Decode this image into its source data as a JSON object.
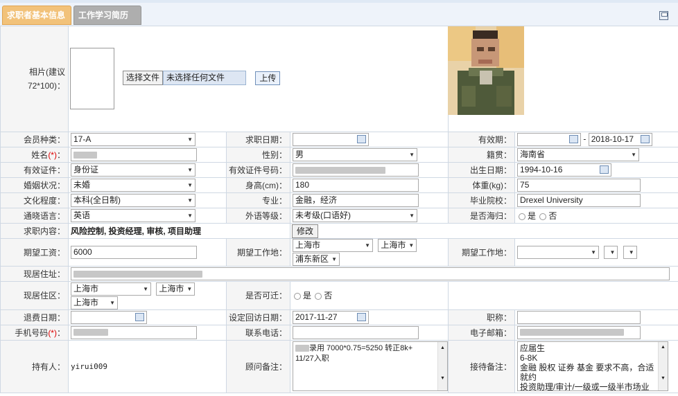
{
  "tabs": {
    "basic": "求职者基本信息",
    "resume": "工作学习简历"
  },
  "photo_label": "相片(建议72*100)：",
  "file": {
    "choose": "选择文件",
    "none": "未选择任何文件",
    "upload": "上传"
  },
  "f": {
    "member_type_l": "会员种类：",
    "member_type": "17-A",
    "apply_date_l": "求职日期：",
    "apply_date": "",
    "valid_l": "有效期：",
    "valid_from": "",
    "valid_dash": "-",
    "valid_to": "2018-10-17",
    "name_l": "姓名",
    "name_req": "(*)",
    "name_colon": "：",
    "gender_l": "性别：",
    "gender": "男",
    "native_l": "籍贯：",
    "native": "海南省",
    "idtype_l": "有效证件：",
    "idtype": "身份证",
    "idno_l": "有效证件号码：",
    "birth_l": "出生日期：",
    "birth": "1994-10-16",
    "marital_l": "婚姻状况：",
    "marital": "未婚",
    "height_l": "身高(cm)：",
    "height": "180",
    "weight_l": "体重(kg)：",
    "weight": "75",
    "edu_l": "文化程度：",
    "edu": "本科(全日制)",
    "major_l": "专业：",
    "major": "金融，经济",
    "school_l": "毕业院校：",
    "school": "Drexel University",
    "lang_l": "通晓语言：",
    "lang": "英语",
    "foreign_l": "外语等级：",
    "foreign": "未考级(口语好)",
    "overseas_l": "是否海归：",
    "yes": "是",
    "no": "否",
    "content_l": "求职内容：",
    "content": "风险控制, 投资经理, 审核, 项目助理",
    "modify": "修改",
    "salary_l": "期望工资：",
    "salary": "6000",
    "work_place_l": "期望工作地：",
    "wp1": "上海市",
    "wp2": "上海市",
    "wp3": "浦东新区",
    "work_place2_l": "期望工作地：",
    "address_l": "现居住址：",
    "live_area_l": "现居住区：",
    "la1": "上海市",
    "la2": "上海市",
    "la3": "上海市",
    "move_l": "是否可迁：",
    "refund_l": "退费日期：",
    "callback_l": "设定回访日期：",
    "callback": "2017-11-27",
    "title_l": "职称：",
    "mobile_l": "手机号码",
    "mobile_req": "(*)",
    "phone_l": "联系电话：",
    "email_l": "电子邮箱：",
    "holder_l": "持有人：",
    "holder": "yirui009",
    "consult_l": "顾问备注：",
    "consult1": "录用 7000*0.75=5250  转正8k+",
    "consult2": "11/27入职",
    "reception_l": "接待备注：",
    "rec1": "应届生",
    "rec2": "6-8K",
    "rec3": "金融 股权 证券 基金 要求不高，合适就约",
    "rec4": "投资助理/审计/一级或一级半市场业务"
  }
}
